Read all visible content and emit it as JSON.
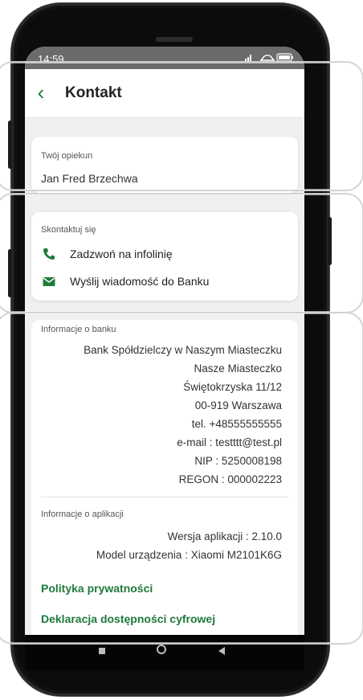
{
  "status": {
    "time": "14:59",
    "icons": "signal wifi battery"
  },
  "header": {
    "title": "Kontakt"
  },
  "guardian": {
    "label": "Twój opiekun",
    "name": "Jan Fred Brzechwa"
  },
  "contact": {
    "label": "Skontaktuj się",
    "call": "Zadzwoń na infolinię",
    "message": "Wyślij wiadomość do Banku"
  },
  "bank": {
    "label": "Informacje o banku",
    "lines": [
      "Bank Spółdzielczy  w Naszym Miasteczku",
      "Nasze Miasteczko",
      "Świętokrzyska 11/12",
      "00-919 Warszawa",
      "tel. +48555555555",
      "e-mail : testttt@test.pl",
      "NIP : 5250008198",
      "REGON : 000002223"
    ]
  },
  "app": {
    "label": "Informacje o aplikacji",
    "version": "Wersja aplikacji : 2.10.0",
    "model": "Model urządzenia : Xiaomi M2101K6G"
  },
  "links": {
    "privacy": "Polityka prywatności",
    "accessibility": "Deklaracja dostępności cyfrowej"
  },
  "colors": {
    "accent": "#1f7a3b",
    "status_bar": "#6b6b6b",
    "screen_bg": "#f0f0f0"
  }
}
